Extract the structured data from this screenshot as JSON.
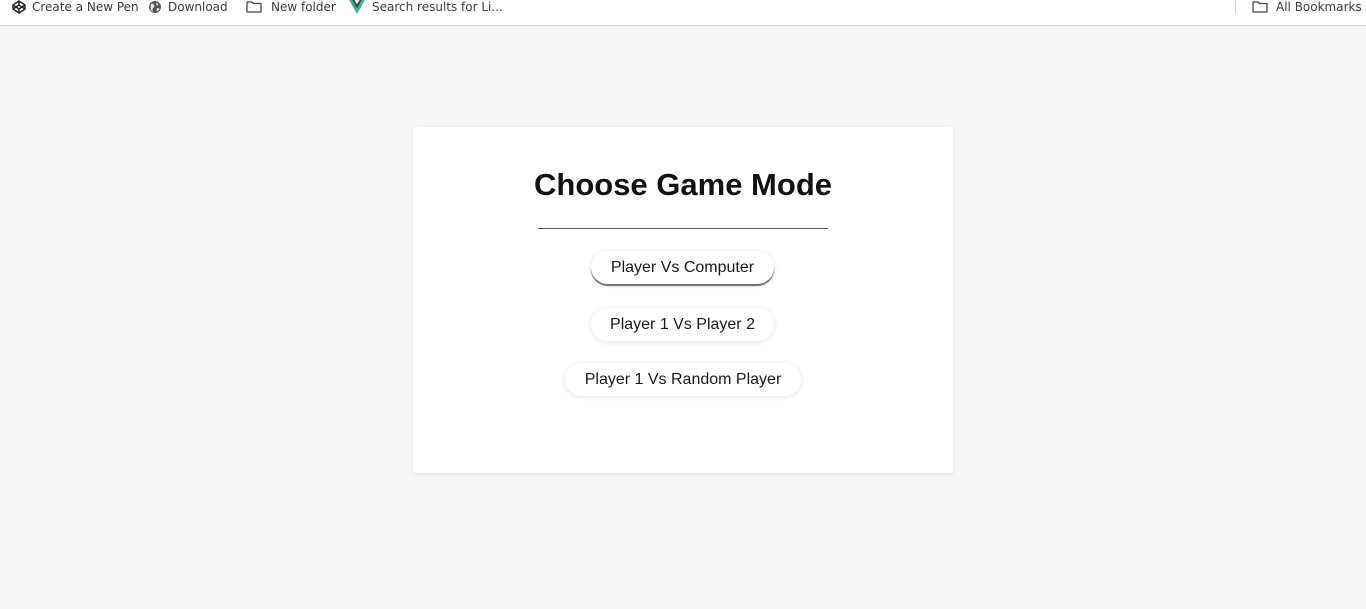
{
  "bookmarks_bar": {
    "items": [
      {
        "label": "Create a New Pen",
        "icon": "codepen-icon"
      },
      {
        "label": "Download",
        "icon": "globe-icon"
      },
      {
        "label": "New folder",
        "icon": "folder-icon"
      },
      {
        "label": "Search results for Li...",
        "icon": "vue-logo-icon"
      }
    ],
    "all_bookmarks": {
      "label": "All Bookmarks",
      "icon": "folder-icon"
    }
  },
  "game_menu": {
    "title": "Choose Game Mode",
    "buttons": [
      {
        "label": "Player Vs Computer"
      },
      {
        "label": "Player 1 Vs Player 2"
      },
      {
        "label": "Player 1 Vs Random Player"
      }
    ]
  },
  "colors": {
    "page_background": "#f7f7f7",
    "card_background": "#ffffff",
    "text": "#111111",
    "vue_green": "#41b883",
    "vue_dark": "#34495e"
  }
}
